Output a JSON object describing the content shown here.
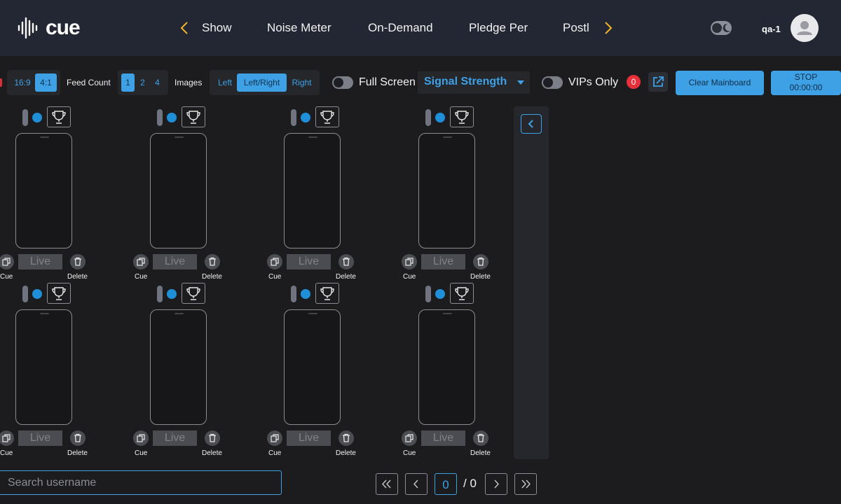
{
  "app": {
    "logo_text": "cue"
  },
  "nav": {
    "tabs": [
      "Show",
      "Noise Meter",
      "On-Demand",
      "Pledge Per",
      "Postl"
    ],
    "user": "qa-1"
  },
  "toolbar": {
    "aspect_options": [
      "16:9",
      "4:1"
    ],
    "aspect_selected": "4:1",
    "feed_count_label": "Feed Count",
    "feed_count_options": [
      "1",
      "2",
      "4"
    ],
    "feed_count_selected": "1",
    "images_label": "Images",
    "image_options": [
      "Left",
      "Left/Right",
      "Right"
    ],
    "image_selected": "Left/Right",
    "fullscreen_label": "Full Screen",
    "sort_select": "Signal Strength",
    "vips_label": "VIPs Only",
    "vips_count": "0",
    "clear_label": "Clear Mainboard",
    "stop_label": "STOP",
    "stop_time": "00:00:00"
  },
  "feeds": [
    {
      "live": "Live",
      "cue": "Cue",
      "delete": "Delete"
    },
    {
      "live": "Live",
      "cue": "Cue",
      "delete": "Delete"
    },
    {
      "live": "Live",
      "cue": "Cue",
      "delete": "Delete"
    },
    {
      "live": "Live",
      "cue": "Cue",
      "delete": "Delete"
    },
    {
      "live": "Live",
      "cue": "Cue",
      "delete": "Delete"
    },
    {
      "live": "Live",
      "cue": "Cue",
      "delete": "Delete"
    },
    {
      "live": "Live",
      "cue": "Cue",
      "delete": "Delete"
    },
    {
      "live": "Live",
      "cue": "Cue",
      "delete": "Delete"
    }
  ],
  "search": {
    "placeholder": "Search username"
  },
  "pagination": {
    "current": "0",
    "total": "/ 0"
  },
  "colors": {
    "accent": "#3ea1e6",
    "nav_bg": "#232733",
    "page_bg": "#1c1c1e",
    "badge": "#e8303a"
  },
  "icons": [
    "logo-waveform-icon",
    "chevron-left-icon",
    "chevron-right-icon",
    "moon-icon",
    "user-icon",
    "trophy-icon",
    "cue-icon",
    "trash-icon",
    "external-link-icon",
    "double-chevron-left-icon",
    "double-chevron-right-icon"
  ]
}
